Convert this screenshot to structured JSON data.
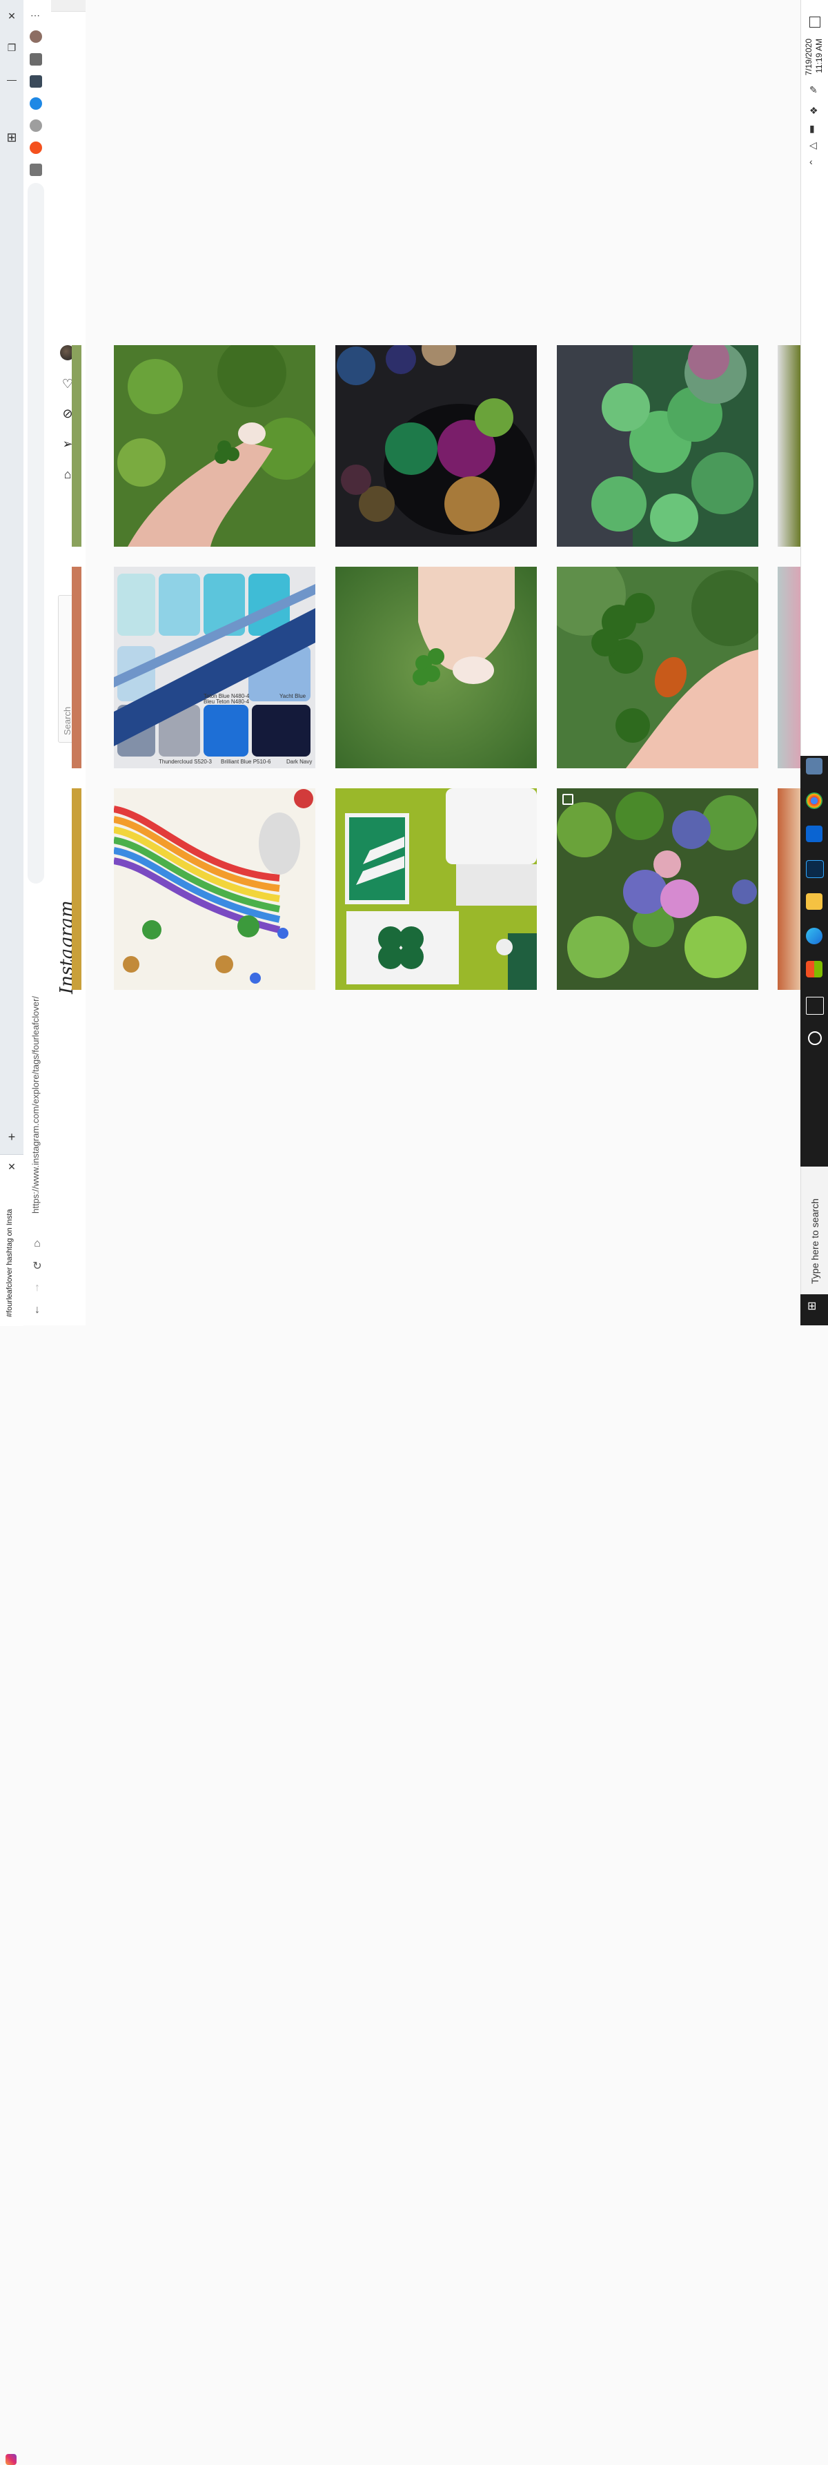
{
  "browser": {
    "tab_title": "#fourleafclover hashtag on Insta",
    "url": "https://www.instagram.com/explore/tags/fourleafclover/",
    "new_tab_symbol": "+",
    "close_symbol": "✕"
  },
  "instagram": {
    "logo": "Instagram",
    "search_placeholder": "Search",
    "nav_icons": [
      "home-icon",
      "direct-icon",
      "explore-icon",
      "activity-heart-icon",
      "profile-avatar"
    ]
  },
  "grid": {
    "rows": [
      [
        "hand holding small clover on grass",
        "marbles and clovers on dark surface",
        "green clover leaves close up"
      ],
      [
        "blue friendship bracelet on paint swatches",
        "fingers holding four leaf clover",
        "hand with orange nail holding clover"
      ],
      [
        "rainbow with bunny and clovers drawing",
        "framed clover art on green wall",
        "blueberries with water drops"
      ]
    ],
    "swatch_labels": [
      "Teton Blue N480-4",
      "Bleu Teton N480-4",
      "Yacht Blue",
      "Thundercloud S520-3",
      "Brilliant Blue P510-6",
      "Dark Navy"
    ]
  },
  "taskbar": {
    "time": "11:19 AM",
    "date": "7/19/2020",
    "search_placeholder": "Type here to search"
  }
}
